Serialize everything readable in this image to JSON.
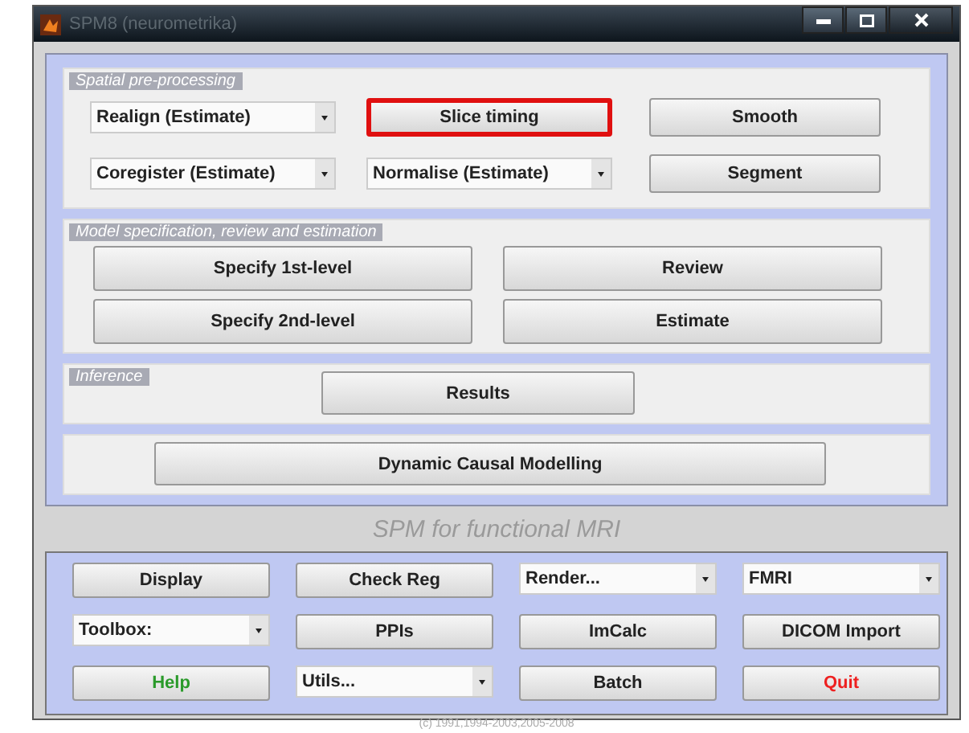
{
  "window": {
    "title": "SPM8 (neurometrika)"
  },
  "sections": [
    {
      "title": "Spatial pre-processing",
      "controls": [
        {
          "kind": "dropdown",
          "label": "Realign (Estimate)",
          "highlighted": false
        },
        {
          "kind": "button",
          "label": "Slice timing",
          "highlighted": true
        },
        {
          "kind": "button",
          "label": "Smooth",
          "highlighted": false
        },
        {
          "kind": "dropdown",
          "label": "Coregister (Estimate)",
          "highlighted": false
        },
        {
          "kind": "dropdown",
          "label": "Normalise (Estimate)",
          "highlighted": false
        },
        {
          "kind": "button",
          "label": "Segment",
          "highlighted": false
        }
      ]
    },
    {
      "title": "Model specification, review and estimation",
      "controls": [
        {
          "kind": "button",
          "label": "Specify 1st-level",
          "highlighted": false
        },
        {
          "kind": "button",
          "label": "Review",
          "highlighted": false
        },
        {
          "kind": "button",
          "label": "Specify 2nd-level",
          "highlighted": false
        },
        {
          "kind": "button",
          "label": "Estimate",
          "highlighted": false
        }
      ]
    },
    {
      "title": "Inference",
      "controls": [
        {
          "kind": "button",
          "label": "Results",
          "highlighted": false
        }
      ]
    },
    {
      "controls": [
        {
          "kind": "button",
          "label": "Dynamic Causal Modelling",
          "highlighted": false
        }
      ]
    }
  ],
  "subtitle": "SPM for functional MRI",
  "utilities": [
    {
      "kind": "button",
      "label": "Display"
    },
    {
      "kind": "button",
      "label": "Check Reg"
    },
    {
      "kind": "dropdown",
      "label": "Render..."
    },
    {
      "kind": "dropdown",
      "label": "FMRI"
    },
    {
      "kind": "dropdown",
      "label": "Toolbox:"
    },
    {
      "kind": "button",
      "label": "PPIs"
    },
    {
      "kind": "button",
      "label": "ImCalc"
    },
    {
      "kind": "button",
      "label": "DICOM Import"
    },
    {
      "kind": "button",
      "label": "Help",
      "color": "#2a9a2a"
    },
    {
      "kind": "dropdown",
      "label": "Utils..."
    },
    {
      "kind": "button",
      "label": "Batch"
    },
    {
      "kind": "button",
      "label": "Quit",
      "color": "#ee2020"
    }
  ],
  "copyright": "(c) 1991,1994-2003,2005-2008"
}
